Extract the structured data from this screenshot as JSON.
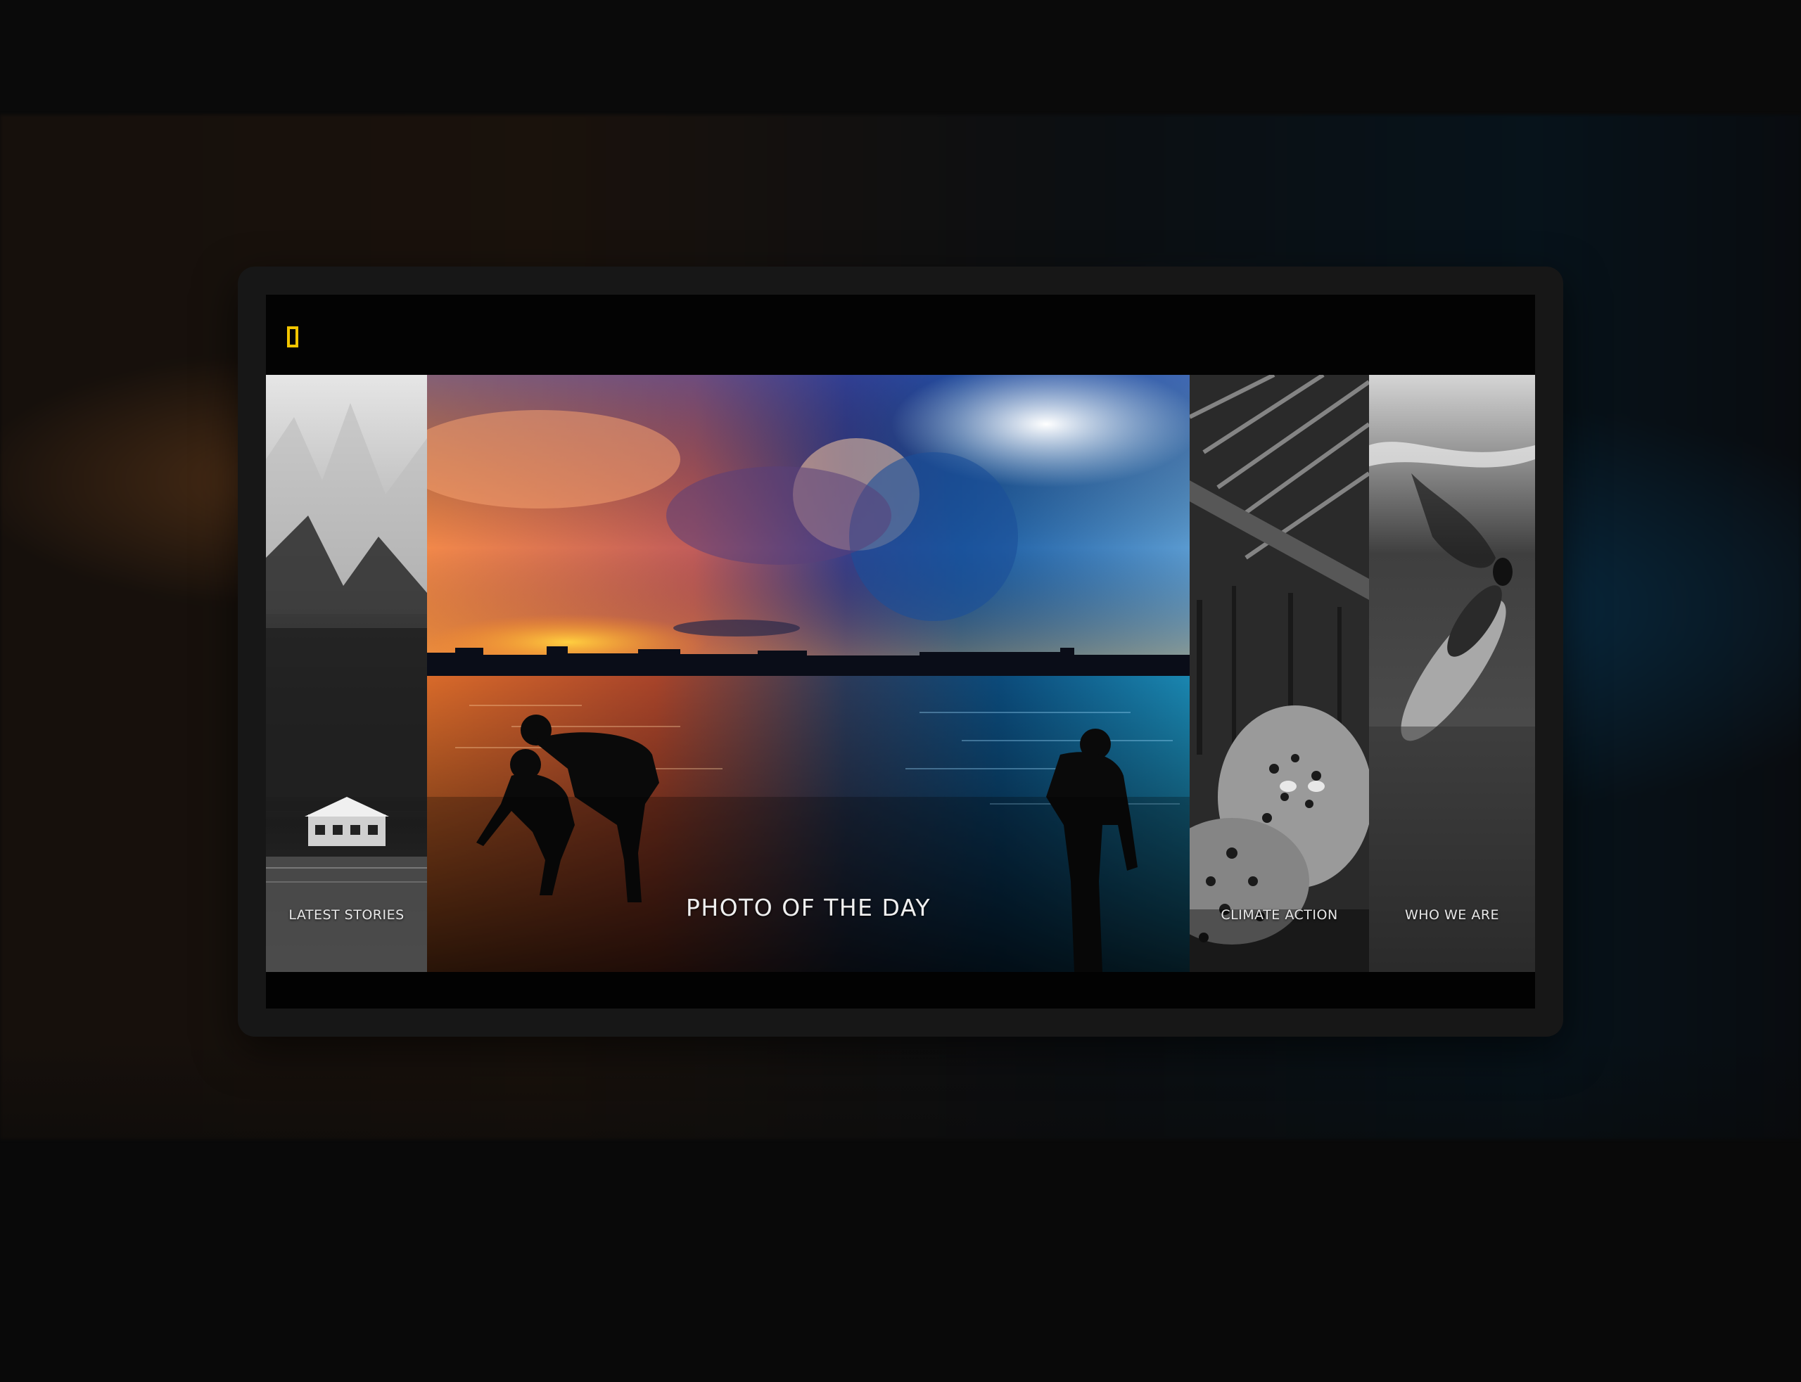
{
  "brand": {
    "logo_icon": "nat-geo-yellow-border-icon",
    "accent": "#f2c500"
  },
  "panels": [
    {
      "id": "latest",
      "label": "LATEST STORIES"
    },
    {
      "id": "photo",
      "label": "PHOTO OF THE DAY"
    },
    {
      "id": "climate",
      "label": "CLIMATE ACTION"
    },
    {
      "id": "who",
      "label": "WHO WE ARE"
    }
  ]
}
